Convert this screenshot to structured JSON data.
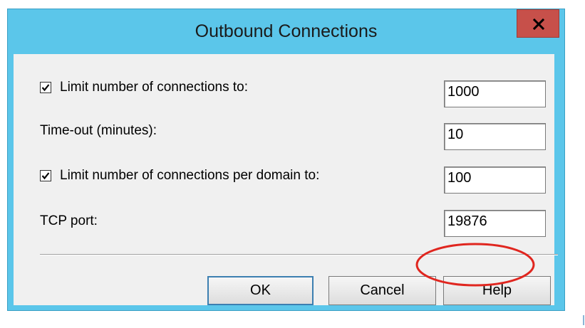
{
  "window": {
    "title": "Outbound Connections",
    "close_icon": "close-icon",
    "title_bar_color": "#5bc6ea",
    "close_button_color": "#c7504a"
  },
  "rows": [
    {
      "label": "Limit number of connections to:",
      "has_checkbox": true,
      "checked": true,
      "value": "1000"
    },
    {
      "label": "Time-out (minutes):",
      "has_checkbox": false,
      "value": "10"
    },
    {
      "label": "Limit number of connections per domain to:",
      "has_checkbox": true,
      "checked": true,
      "value": "100"
    },
    {
      "label": "TCP port:",
      "has_checkbox": false,
      "value": "19876"
    }
  ],
  "buttons": {
    "ok": "OK",
    "cancel": "Cancel",
    "help": "Help"
  },
  "annotation": {
    "shape": "ellipse",
    "color": "#e0261f",
    "highlights": "TCP port value"
  }
}
